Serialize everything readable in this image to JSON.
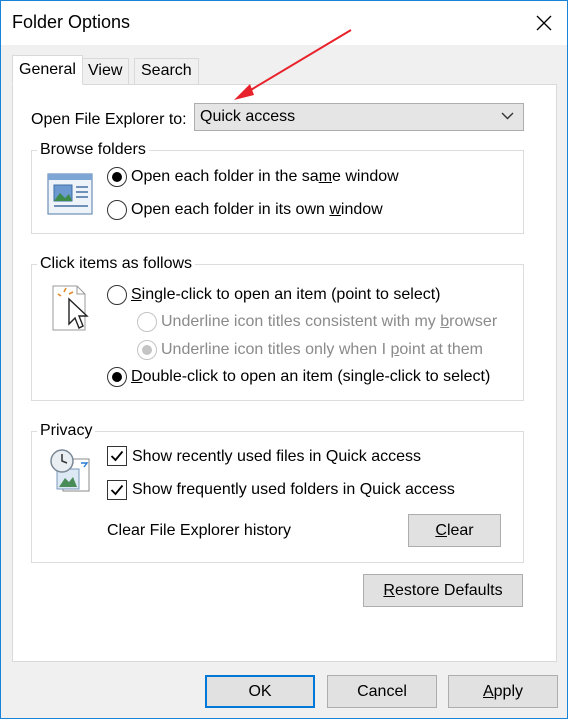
{
  "window": {
    "title": "Folder Options"
  },
  "tabs": [
    {
      "label": "General",
      "active": true
    },
    {
      "label": "View",
      "active": false
    },
    {
      "label": "Search",
      "active": false
    }
  ],
  "open_explorer": {
    "label": "Open File Explorer to:",
    "value": "Quick access"
  },
  "browse_folders": {
    "title": "Browse folders",
    "options": [
      {
        "pre": "Open each folder in the sa",
        "u": "m",
        "post": "e window",
        "checked": true
      },
      {
        "pre": "Open each folder in its own ",
        "u": "w",
        "post": "indow",
        "checked": false
      }
    ]
  },
  "click_items": {
    "title": "Click items as follows",
    "single": {
      "pre": "",
      "u": "S",
      "post": "ingle-click to open an item (point to select)",
      "checked": false
    },
    "underline_browser": {
      "pre": "Underline icon titles consistent with my ",
      "u": "b",
      "post": "rowser",
      "checked": false
    },
    "underline_point": {
      "pre": "Underline icon titles only when I ",
      "u": "p",
      "post": "oint at them",
      "checked": true
    },
    "double": {
      "pre": "",
      "u": "D",
      "post": "ouble-click to open an item (single-click to select)",
      "checked": true
    }
  },
  "privacy": {
    "title": "Privacy",
    "recent": {
      "label": "Show recently used files in Quick access",
      "checked": true
    },
    "frequent": {
      "label": "Show frequently used folders in Quick access",
      "checked": true
    },
    "clear_history_label": "Clear File Explorer history",
    "clear_button": {
      "u": "C",
      "post": "lear"
    }
  },
  "restore_defaults": {
    "u": "R",
    "post": "estore Defaults"
  },
  "footer": {
    "ok": "OK",
    "cancel": "Cancel",
    "apply": {
      "u": "A",
      "post": "pply"
    }
  },
  "colors": {
    "accent": "#0078d7",
    "annotation_arrow": "#e8222a"
  },
  "icons": [
    "close-icon",
    "chevron-down-icon",
    "window-preview-icon",
    "cursor-click-icon",
    "clock-document-icon",
    "checkmark-icon",
    "red-arrow-annotation"
  ]
}
